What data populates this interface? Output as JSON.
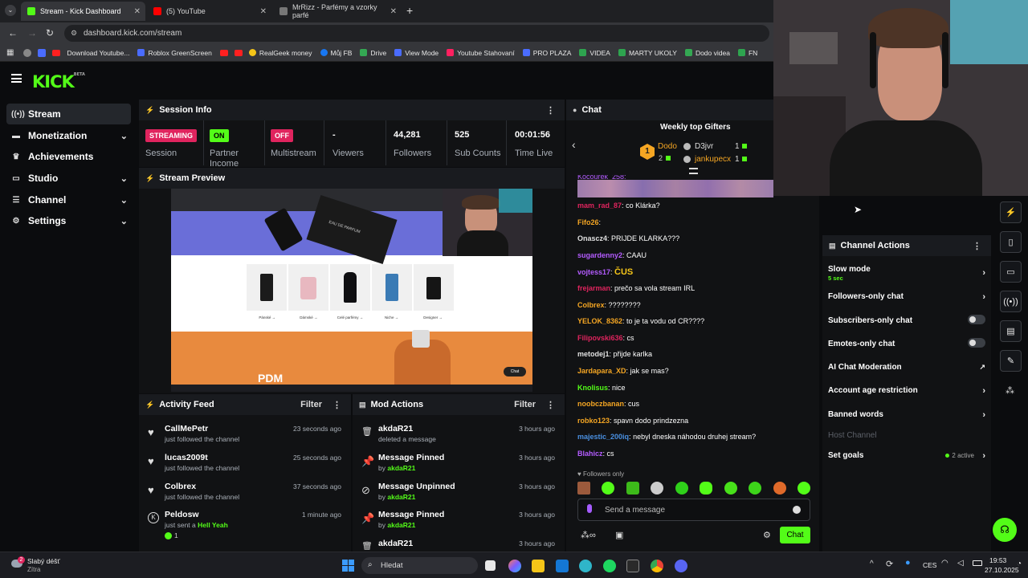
{
  "browser": {
    "tabs": [
      {
        "title": "Stream - Kick Dashboard",
        "active": true,
        "color": "#53fc18"
      },
      {
        "title": "(5) YouTube",
        "active": false,
        "color": "#ff0000"
      },
      {
        "title": "MrRizz - Parfémy a vzorky parfé",
        "active": false,
        "color": "#888888"
      }
    ],
    "new_tab": "+",
    "url": "dashboard.kick.com/stream",
    "bookmarks": [
      "Download Youtube...",
      "Roblox GreenScreen",
      "RealGeek money",
      "Můj FB",
      "Drive",
      "View Mode",
      "Youtube Stahovaní",
      "PRO PLAZA",
      "VIDEA",
      "MARTY UKOLY",
      "Dodo videa",
      "FN"
    ]
  },
  "kick": {
    "logo": "KICK",
    "logo_sup": "BETA",
    "accent": "#53fc18"
  },
  "sidebar": {
    "items": [
      {
        "label": "Stream",
        "icon": "broadcast-icon"
      },
      {
        "label": "Monetization",
        "icon": "money-icon"
      },
      {
        "label": "Achievements",
        "icon": "trophy-icon"
      },
      {
        "label": "Studio",
        "icon": "studio-icon"
      },
      {
        "label": "Channel",
        "icon": "channel-icon"
      },
      {
        "label": "Settings",
        "icon": "gear-icon"
      }
    ]
  },
  "session": {
    "title": "Session Info",
    "stats": [
      {
        "badge": "STREAMING",
        "label": "Session"
      },
      {
        "badge": "ON",
        "label": "Partner Income"
      },
      {
        "badge": "OFF",
        "label": "Multistream"
      },
      {
        "value": "-",
        "label": "Viewers"
      },
      {
        "value": "44,281",
        "label": "Followers"
      },
      {
        "value": "525",
        "label": "Sub Counts"
      },
      {
        "value": "00:01:56",
        "label": "Time Live"
      }
    ]
  },
  "preview": {
    "title": "Stream Preview",
    "eau_de_parfum": "EAU DE PARFUM",
    "categories": [
      "Pánské →",
      "Dámské →",
      "Celé parfémy →",
      "Niche →",
      "Designer →"
    ],
    "banner_text": "PDM",
    "chat_button": "Chat"
  },
  "activity": {
    "title": "Activity Feed",
    "filter": "Filter",
    "rows": [
      {
        "name": "CallMePetr",
        "sub": "just followed the channel",
        "time": "23 seconds ago"
      },
      {
        "name": "lucas2009t",
        "sub": "just followed the channel",
        "time": "25 seconds ago"
      },
      {
        "name": "Colbrex",
        "sub": "just followed the channel",
        "time": "37 seconds ago"
      },
      {
        "name": "Peldosw",
        "sub": "just sent a",
        "sub_highlight": "Hell Yeah",
        "count": "1",
        "time": "1 minute ago"
      }
    ]
  },
  "mod": {
    "title": "Mod Actions",
    "filter": "Filter",
    "rows": [
      {
        "name": "akdaR21",
        "sub": "deleted a message",
        "time": "3 hours ago"
      },
      {
        "name": "Message Pinned",
        "sub": "by",
        "by": "akdaR21",
        "time": "3 hours ago"
      },
      {
        "name": "Message Unpinned",
        "sub": "by",
        "by": "akdaR21",
        "time": "3 hours ago"
      },
      {
        "name": "Message Pinned",
        "sub": "by",
        "by": "akdaR21",
        "time": "3 hours ago"
      },
      {
        "name": "akdaR21",
        "sub": "",
        "time": "3 hours ago"
      }
    ]
  },
  "chat": {
    "title": "Chat",
    "gifters_title": "Weekly top Gifters",
    "gifters": [
      {
        "rank": "1",
        "name": "Dodo",
        "count": "2"
      },
      {
        "name": "D3jvr",
        "count": "1"
      },
      {
        "name": "jankupecx",
        "count": "1"
      }
    ],
    "truncated_user": "Kocourek_258:",
    "messages": [
      {
        "user": "mam_rad_87",
        "text": "co Klárka?",
        "color": "#e0245e"
      },
      {
        "user": "Fifo26",
        "text": "",
        "color": "#f5a623"
      },
      {
        "user": "Onascz4",
        "text": "PRIJDE KLARKA???",
        "color": "#e0e0e0"
      },
      {
        "user": "sugardenny2",
        "text": "CAAU",
        "color": "#b45cff"
      },
      {
        "user": "vojtess17",
        "text": "ČUS",
        "color": "#b45cff"
      },
      {
        "user": "frejarman",
        "text": "prečo sa vola stream IRL",
        "color": "#e0245e"
      },
      {
        "user": "Colbrex",
        "text": "????????",
        "color": "#f5a623"
      },
      {
        "user": "YELOK_8362",
        "text": "to je ta vodu od CR????",
        "color": "#f5a623"
      },
      {
        "user": "Filipovski636",
        "text": "cs",
        "color": "#e0245e"
      },
      {
        "user": "metodej1",
        "text": "přijde karlka",
        "color": "#e0e0e0"
      },
      {
        "user": "Jardapara_XD",
        "text": "jak se mas?",
        "color": "#f5a623"
      },
      {
        "user": "Knolisus",
        "text": "nice",
        "color": "#53fc18"
      },
      {
        "user": "noobczbanan",
        "text": "cus",
        "color": "#f5a623"
      },
      {
        "user": "robko123",
        "text": "spavn dodo prindzezna",
        "color": "#f5a623"
      },
      {
        "user": "majestic_200iq",
        "text": "nebyl dneska náhodou druhej stream?",
        "color": "#4a90e2"
      },
      {
        "user": "Blahicz",
        "text": "cs",
        "color": "#b45cff"
      }
    ],
    "followers_only": "Followers only",
    "placeholder": "Send a message",
    "send": "Chat"
  },
  "channel_actions": {
    "title": "Channel Actions",
    "items": [
      {
        "label": "Slow mode",
        "sub": "5 sec",
        "control": "chevron"
      },
      {
        "label": "Followers-only chat",
        "control": "chevron"
      },
      {
        "label": "Subscribers-only chat",
        "control": "toggle"
      },
      {
        "label": "Emotes-only chat",
        "control": "toggle"
      },
      {
        "label": "AI Chat Moderation",
        "control": "external"
      },
      {
        "label": "Account age restriction",
        "control": "chevron"
      },
      {
        "label": "Banned words",
        "control": "chevron"
      },
      {
        "label": "Host Channel",
        "control": "none",
        "disabled": true
      },
      {
        "label": "Set goals",
        "control": "chevron",
        "extra": "2 active"
      }
    ]
  },
  "taskbar": {
    "weather_title": "Slabý déšť",
    "weather_sub": "Zítra",
    "weather_badge": "2",
    "search": "Hledat",
    "lang": "CES",
    "time": "19:53",
    "date": "27.10.2025"
  }
}
